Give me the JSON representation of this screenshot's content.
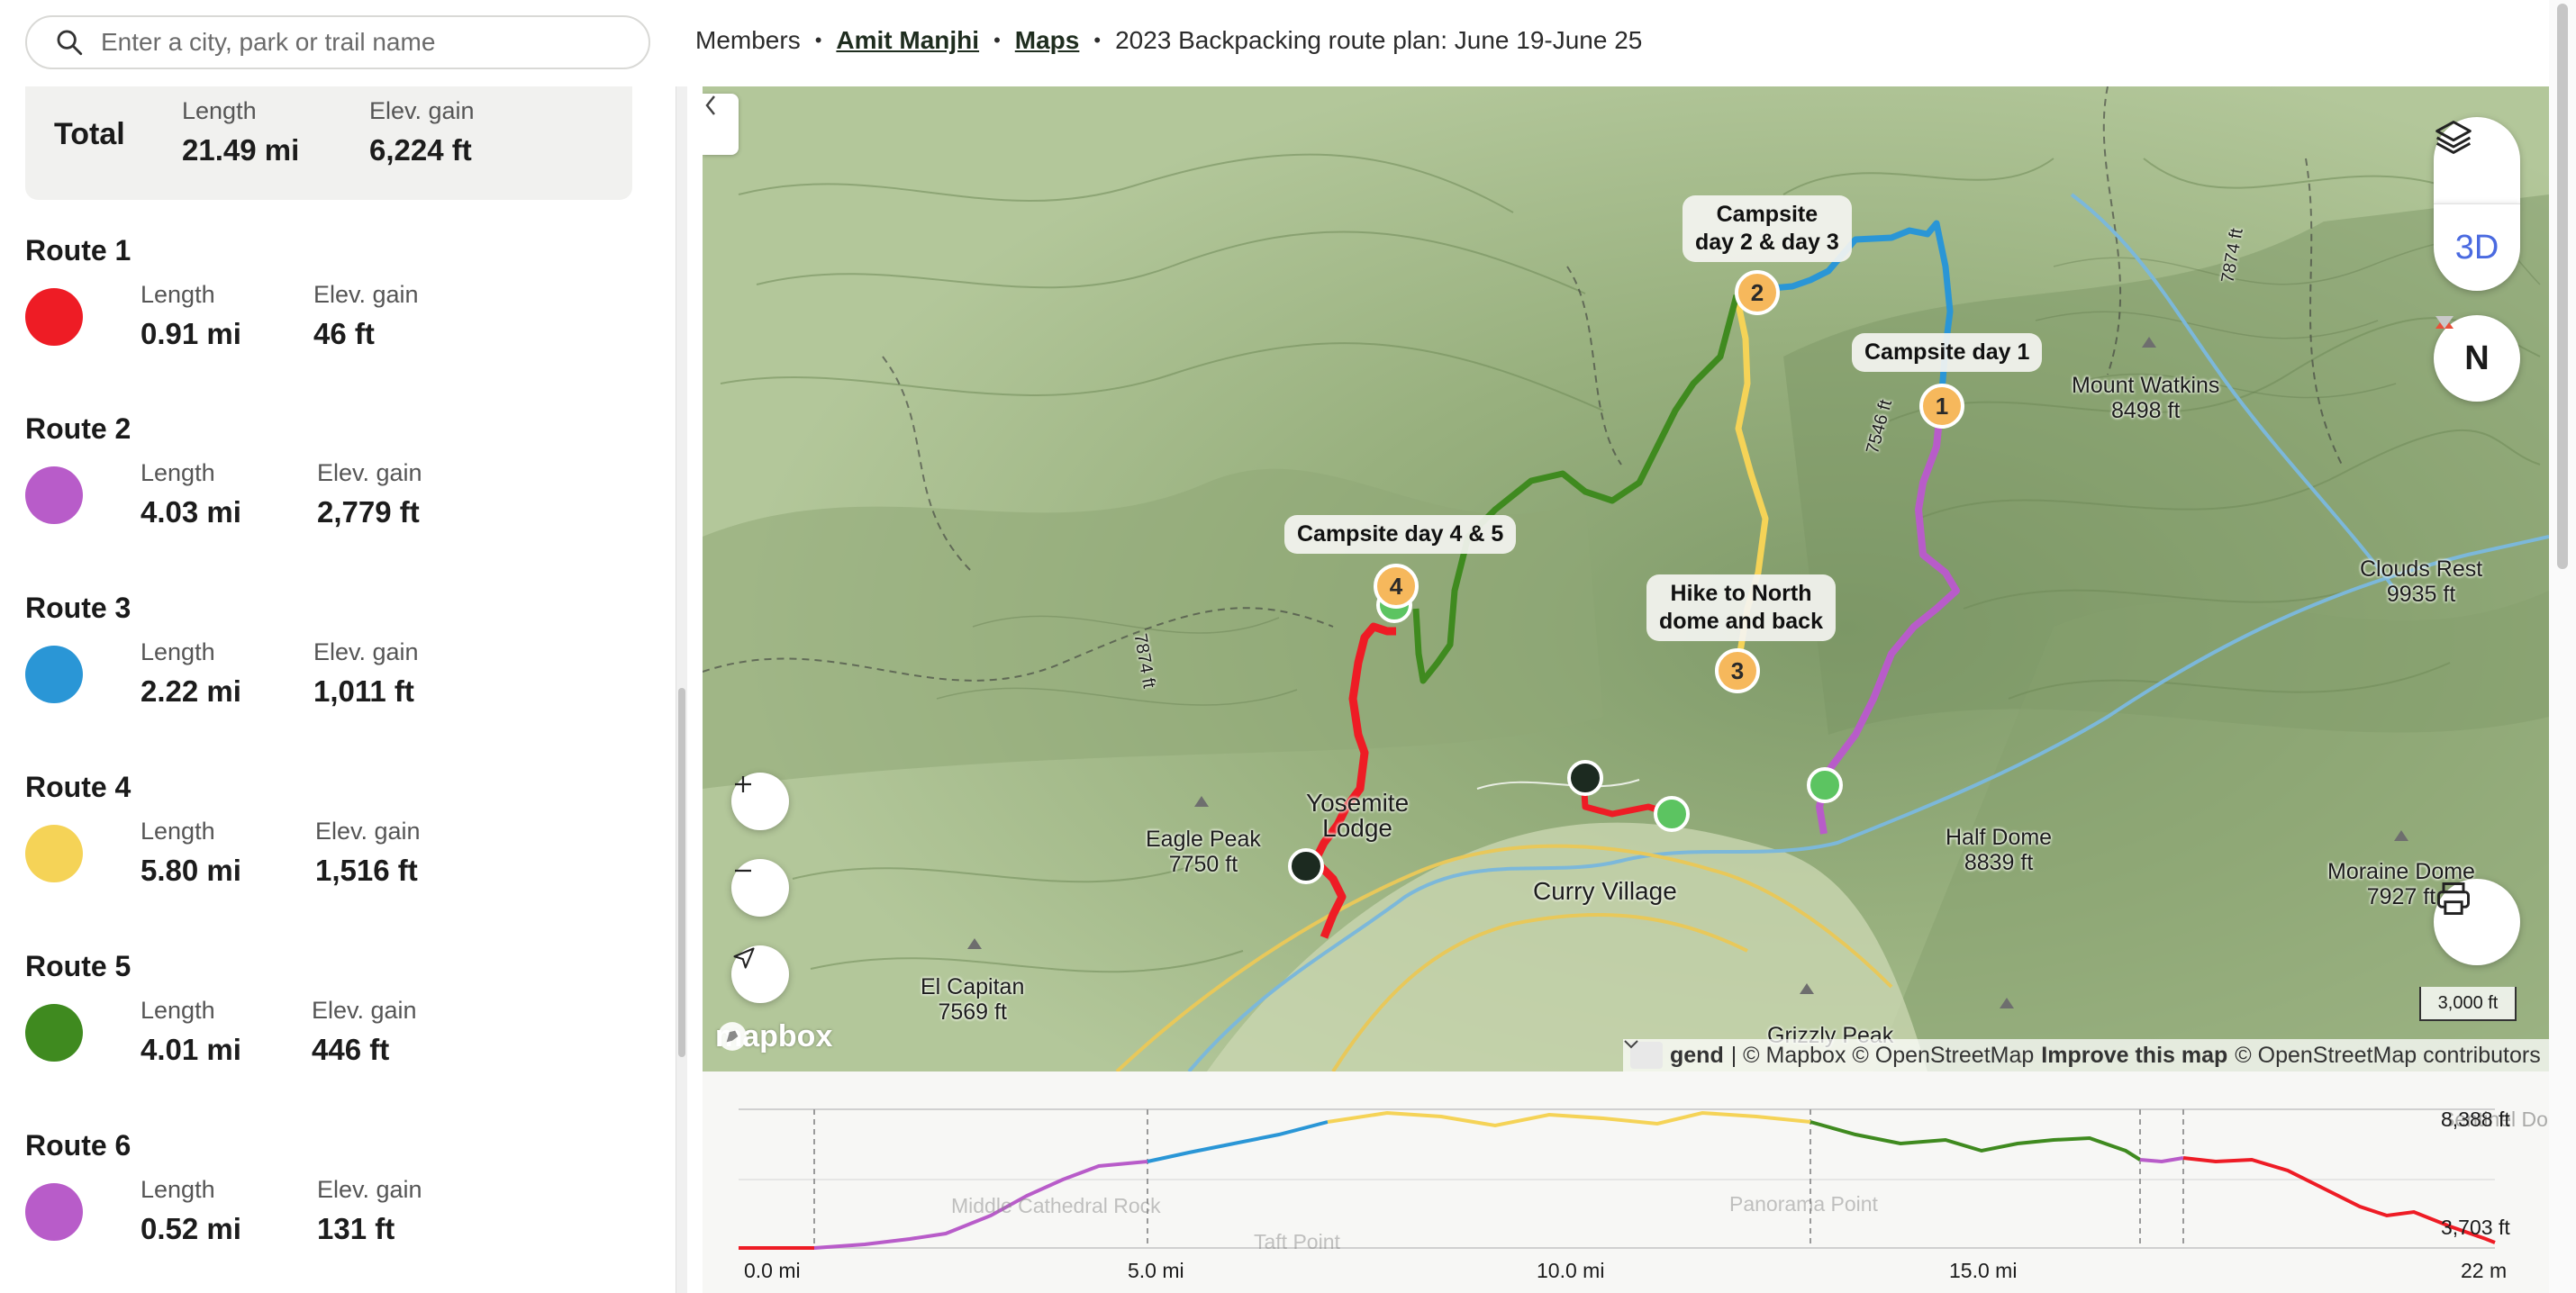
{
  "search": {
    "placeholder": "Enter a city, park or trail name"
  },
  "breadcrumb": {
    "members": "Members",
    "user": "Amit Manjhi",
    "maps": "Maps",
    "title": "2023 Backpacking route plan: June 19-June 25"
  },
  "total": {
    "label": "Total",
    "length_label": "Length",
    "length": "21.49 mi",
    "elev_label": "Elev. gain",
    "elev": "6,224 ft"
  },
  "routes": [
    {
      "name": "Route 1",
      "color": "#ee1c25",
      "length_label": "Length",
      "length": "0.91 mi",
      "elev_label": "Elev. gain",
      "elev": "46 ft"
    },
    {
      "name": "Route 2",
      "color": "#b85cc9",
      "length_label": "Length",
      "length": "4.03 mi",
      "elev_label": "Elev. gain",
      "elev": "2,779 ft"
    },
    {
      "name": "Route 3",
      "color": "#2a96d6",
      "length_label": "Length",
      "length": "2.22 mi",
      "elev_label": "Elev. gain",
      "elev": "1,011 ft"
    },
    {
      "name": "Route 4",
      "color": "#f5d357",
      "length_label": "Length",
      "length": "5.80 mi",
      "elev_label": "Elev. gain",
      "elev": "1,516 ft"
    },
    {
      "name": "Route 5",
      "color": "#3f8a1f",
      "length_label": "Length",
      "length": "4.01 mi",
      "elev_label": "Elev. gain",
      "elev": "446 ft"
    },
    {
      "name": "Route 6",
      "color": "#b85cc9",
      "length_label": "Length",
      "length": "0.52 mi",
      "elev_label": "Elev. gain",
      "elev": "131 ft"
    }
  ],
  "map": {
    "callouts": {
      "campsite_23": "Campsite day 2 & day 3",
      "campsite_23_l1": "Campsite",
      "campsite_23_l2": "day 2 & day 3",
      "campsite_1": "Campsite day 1",
      "campsite_45": "Campsite day 4 & 5",
      "north_dome_l1": "Hike to North",
      "north_dome_l2": "dome and back"
    },
    "pins": {
      "p1": "1",
      "p2": "2",
      "p3": "3",
      "p4": "4"
    },
    "labels": {
      "mount_watkins_name": "Mount Watkins",
      "mount_watkins_elev": "8498 ft",
      "clouds_rest_name": "Clouds Rest",
      "clouds_rest_elev": "9935 ft",
      "half_dome_name": "Half Dome",
      "half_dome_elev": "8839 ft",
      "moraine_name": "Moraine Dome",
      "moraine_elev": "7927 ft",
      "eagle_peak_name": "Eagle Peak",
      "eagle_peak_elev": "7750 ft",
      "el_capitan_name": "El Capitan",
      "el_capitan_elev": "7569 ft",
      "yosemite_l1": "Yosemite",
      "yosemite_l2": "Lodge",
      "curry_village": "Curry Village",
      "grizzly_peak": "Grizzly Peak",
      "contour_7874": "7874 ft",
      "contour_7546": "7546 ft",
      "contour_7874b": "7874 ft"
    },
    "controls": {
      "three_d": "3D",
      "north": "N"
    },
    "scale": "3,000 ft",
    "logo": "mapbox",
    "attribution": {
      "legend": "gend",
      "mapbox": "| © Mapbox © OpenStreetMap",
      "improve": "Improve this map",
      "osm": "© OpenStreetMap contributors"
    }
  },
  "elevation": {
    "max_label": "8,388 ft",
    "min_label": "3,703 ft",
    "x_ticks": [
      "0.0 mi",
      "5.0 mi",
      "10.0 mi",
      "15.0 mi",
      "22 m"
    ],
    "ghost_labels": [
      "Middle Cathedral Rock",
      "Taft Point",
      "Sentinel Dome",
      "Panorama Point"
    ]
  }
}
